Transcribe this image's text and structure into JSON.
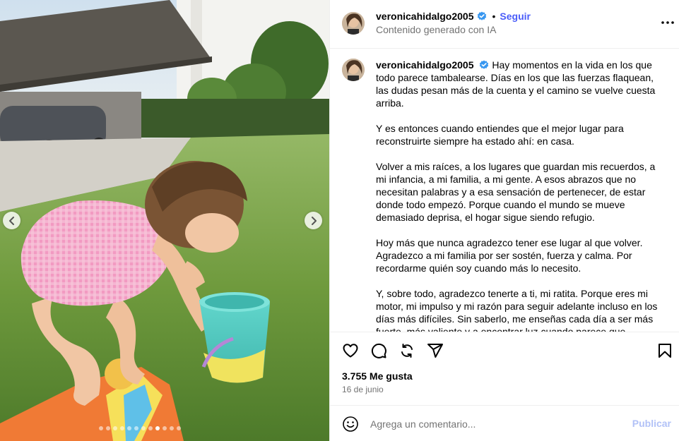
{
  "post": {
    "username": "veronicahidalgo2005",
    "follow_label": "Seguir",
    "separator": "•",
    "subtitle": "Contenido generado con IA",
    "caption_paragraphs": [
      "Hay momentos en la vida en los que todo parece tambalearse. Días en los que las fuerzas flaquean, las dudas pesan más de la cuenta y el camino se vuelve cuesta arriba.",
      "Y es entonces cuando entiendes que el mejor lugar para reconstruirte siempre ha estado ahí: en casa.",
      "Volver a mis raíces, a los lugares que guardan mis recuerdos, a mi infancia, a mi familia, a mi gente. A esos abrazos que no necesitan palabras y a esa sensación de pertenecer, de estar donde todo empezó. Porque cuando el mundo se mueve demasiado deprisa, el hogar sigue siendo refugio.",
      "Hoy más que nunca agradezco tener ese lugar al que volver. Agradezco a mi familia por ser sostén, fuerza y calma. Por recordarme quién soy cuando más lo necesito.",
      "Y, sobre todo, agradezco tenerte a ti, mi ratita. Porque eres mi motor, mi impulso y mi razón para seguir adelante incluso en los días más difíciles. Sin saberlo, me enseñas cada día a ser más fuerte, más valiente y a encontrar luz cuando parece que"
    ],
    "likes": "3.755 Me gusta",
    "date": "16 de junio"
  },
  "comment": {
    "placeholder": "Agrega un comentario...",
    "publish_label": "Publicar"
  },
  "carousel": {
    "total_slides": 12,
    "active_slide_index": 8
  },
  "icons": {
    "verified": "verified-badge-icon",
    "more": "more-options-icon",
    "like": "heart-icon",
    "comment": "comment-icon",
    "repost": "repost-icon",
    "share": "send-icon",
    "save": "bookmark-icon",
    "emoji": "emoji-icon",
    "prev": "chevron-left-icon",
    "next": "chevron-right-icon"
  },
  "colors": {
    "follow": "#4a5df9",
    "verified": "#3897f0",
    "publish_disabled": "#b2c2f7",
    "secondary_text": "#737373"
  }
}
